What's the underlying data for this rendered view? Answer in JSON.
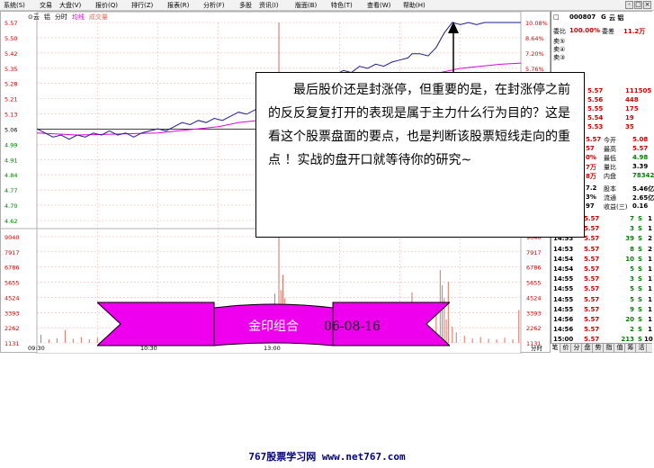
{
  "menu": [
    "系统(S)",
    "交易",
    "大盘(V)",
    "报价(Q)",
    "排行(Z)",
    "报表(R)",
    "分析(F)",
    "多股",
    "资讯(I)",
    "版面(B)",
    "特色(T)",
    "查看(W)",
    "帮助(H)"
  ],
  "window_controls": [
    "-",
    "□",
    "×"
  ],
  "chart": {
    "legend": {
      "prefix": "⊙云",
      "name": "铝",
      "view": "分时",
      "indicator": "均线",
      "volume": "成交量"
    },
    "price_ticks": [
      "5.57",
      "5.50",
      "5.42",
      "5.35",
      "5.28",
      "5.21",
      "5.13",
      "5.06",
      "4.99",
      "4.91",
      "4.84",
      "4.77",
      "4.70",
      "4.62"
    ],
    "pct_ticks": [
      "10.08%",
      "8.64%",
      "7.20%",
      "5.76%"
    ],
    "pct_tick_lower": "8.64%",
    "volume_ticks": [
      "9040",
      "7917",
      "6786",
      "5655",
      "4524",
      "3393",
      "2262",
      "1131"
    ],
    "time_labels": [
      "09:30",
      "10:30",
      "13:00"
    ],
    "bottom_right_label": "分时",
    "price_min": 4.62,
    "price_max": 5.57,
    "volume_max": 9040,
    "price_series": [
      [
        0,
        5.06
      ],
      [
        4,
        5.04
      ],
      [
        8,
        5.02
      ],
      [
        12,
        5.03
      ],
      [
        16,
        5.01
      ],
      [
        20,
        5.03
      ],
      [
        24,
        5.02
      ],
      [
        28,
        5.04
      ],
      [
        32,
        5.03
      ],
      [
        36,
        5.05
      ],
      [
        40,
        5.03
      ],
      [
        44,
        5.04
      ],
      [
        48,
        5.02
      ],
      [
        52,
        5.04
      ],
      [
        56,
        5.05
      ],
      [
        60,
        5.06
      ],
      [
        64,
        5.05
      ],
      [
        68,
        5.07
      ],
      [
        72,
        5.09
      ],
      [
        76,
        5.08
      ],
      [
        80,
        5.1
      ],
      [
        84,
        5.09
      ],
      [
        88,
        5.11
      ],
      [
        92,
        5.1
      ],
      [
        96,
        5.12
      ],
      [
        100,
        5.14
      ],
      [
        104,
        5.13
      ],
      [
        108,
        5.15
      ],
      [
        112,
        5.17
      ],
      [
        116,
        5.16
      ],
      [
        118,
        5.18
      ],
      [
        120,
        5.21
      ],
      [
        124,
        5.24
      ],
      [
        128,
        5.27
      ],
      [
        132,
        5.3
      ],
      [
        136,
        5.29
      ],
      [
        140,
        5.31
      ],
      [
        144,
        5.33
      ],
      [
        148,
        5.32
      ],
      [
        152,
        5.34
      ],
      [
        156,
        5.33
      ],
      [
        160,
        5.36
      ],
      [
        164,
        5.35
      ],
      [
        168,
        5.37
      ],
      [
        172,
        5.36
      ],
      [
        176,
        5.38
      ],
      [
        180,
        5.39
      ],
      [
        184,
        5.4
      ],
      [
        186,
        5.42
      ],
      [
        190,
        5.42
      ],
      [
        194,
        5.41
      ],
      [
        198,
        5.45
      ],
      [
        202,
        5.52
      ],
      [
        206,
        5.57
      ],
      [
        210,
        5.56
      ],
      [
        214,
        5.57
      ],
      [
        218,
        5.56
      ],
      [
        222,
        5.57
      ],
      [
        226,
        5.57
      ],
      [
        230,
        5.57
      ],
      [
        234,
        5.57
      ],
      [
        240,
        5.57
      ]
    ],
    "avg_series": [
      [
        0,
        5.04
      ],
      [
        20,
        5.03
      ],
      [
        40,
        5.035
      ],
      [
        60,
        5.04
      ],
      [
        70,
        5.05
      ],
      [
        80,
        5.06
      ],
      [
        90,
        5.07
      ],
      [
        100,
        5.09
      ],
      [
        110,
        5.1
      ],
      [
        120,
        5.12
      ],
      [
        130,
        5.15
      ],
      [
        140,
        5.2
      ],
      [
        150,
        5.23
      ],
      [
        160,
        5.25
      ],
      [
        170,
        5.27
      ],
      [
        180,
        5.29
      ],
      [
        190,
        5.31
      ],
      [
        200,
        5.33
      ],
      [
        210,
        5.35
      ],
      [
        220,
        5.36
      ],
      [
        230,
        5.37
      ],
      [
        240,
        5.375
      ]
    ],
    "volume_bars": [
      [
        2,
        700
      ],
      [
        6,
        300
      ],
      [
        10,
        400
      ],
      [
        14,
        1100
      ],
      [
        18,
        350
      ],
      [
        22,
        500
      ],
      [
        26,
        300
      ],
      [
        30,
        450
      ],
      [
        34,
        250
      ],
      [
        38,
        400
      ],
      [
        42,
        300
      ],
      [
        46,
        350
      ],
      [
        50,
        250
      ],
      [
        54,
        300
      ],
      [
        58,
        280
      ],
      [
        62,
        260
      ],
      [
        66,
        300
      ],
      [
        70,
        500
      ],
      [
        74,
        320
      ],
      [
        78,
        280
      ],
      [
        82,
        350
      ],
      [
        86,
        300
      ],
      [
        90,
        420
      ],
      [
        94,
        380
      ],
      [
        98,
        500
      ],
      [
        102,
        450
      ],
      [
        104,
        1500
      ],
      [
        106,
        700
      ],
      [
        108,
        400
      ],
      [
        112,
        300
      ],
      [
        116,
        600
      ],
      [
        118,
        4200
      ],
      [
        119,
        3100
      ],
      [
        120,
        5400
      ],
      [
        121,
        4500
      ],
      [
        122,
        5800
      ],
      [
        123,
        3800
      ],
      [
        124,
        2500
      ],
      [
        126,
        1500
      ],
      [
        128,
        900
      ],
      [
        132,
        700
      ],
      [
        136,
        600
      ],
      [
        140,
        500
      ],
      [
        144,
        450
      ],
      [
        148,
        500
      ],
      [
        152,
        600
      ],
      [
        156,
        700
      ],
      [
        160,
        900
      ],
      [
        164,
        600
      ],
      [
        168,
        800
      ],
      [
        172,
        700
      ],
      [
        176,
        1100
      ],
      [
        178,
        2900
      ],
      [
        180,
        3100
      ],
      [
        182,
        1500
      ],
      [
        184,
        2200
      ],
      [
        186,
        4300
      ],
      [
        188,
        1000
      ],
      [
        192,
        800
      ],
      [
        196,
        1200
      ],
      [
        198,
        3300
      ],
      [
        200,
        6200
      ],
      [
        201,
        4900
      ],
      [
        202,
        3800
      ],
      [
        203,
        2000
      ],
      [
        204,
        5200
      ],
      [
        206,
        1400
      ],
      [
        208,
        900
      ],
      [
        212,
        600
      ],
      [
        216,
        400
      ],
      [
        220,
        500
      ],
      [
        224,
        350
      ],
      [
        228,
        300
      ],
      [
        232,
        450
      ],
      [
        236,
        300
      ],
      [
        239,
        2800
      ]
    ]
  },
  "quote": {
    "code": "000807",
    "flag": "G",
    "name": "云 铝",
    "weibi_label": "委比",
    "weibi_value": "100.00%",
    "weicha_label": "委差",
    "weicha_value": "11.2万",
    "sell_levels": [
      "卖⑤",
      "卖④",
      "卖③"
    ],
    "book_rows": [
      {
        "price": "5.57",
        "qty": "111505"
      },
      {
        "price": "5.56",
        "qty": "448"
      },
      {
        "price": "5.55",
        "qty": "175"
      },
      {
        "price": "5.54",
        "qty": "19"
      },
      {
        "price": "5.53",
        "qty": "35"
      }
    ],
    "stats": [
      {
        "left": "5.57",
        "label": "今开",
        "value": "5.08"
      },
      {
        "left": "57",
        "label": "最高",
        "value": "5.57"
      },
      {
        "left": "0%",
        "label": "最低",
        "value": "4.98"
      },
      {
        "left": "7万",
        "label": "量比",
        "value": "3.39"
      },
      {
        "left": "8万",
        "label": "内盘",
        "value": "78342"
      }
    ],
    "fundamentals": [
      {
        "left": "7.2",
        "label": "股本",
        "value": "5.46亿"
      },
      {
        "left": "3%",
        "label": "流通",
        "value": "2.65亿"
      },
      {
        "left": "97",
        "label": "收益(三)",
        "value": "0.16"
      }
    ],
    "ticks": [
      {
        "time": "14:53",
        "price": "5.57",
        "vol": "7",
        "side": "S",
        "n": "1"
      },
      {
        "time": "14:53",
        "price": "5.57",
        "vol": "3",
        "side": "S",
        "n": "1"
      },
      {
        "time": "14:53",
        "price": "5.57",
        "vol": "39",
        "side": "S",
        "n": "2"
      },
      {
        "time": "14:53",
        "price": "5.57",
        "vol": "8",
        "side": "S",
        "n": "2"
      },
      {
        "time": "14:54",
        "price": "5.57",
        "vol": "10",
        "side": "S",
        "n": "1"
      },
      {
        "time": "14:54",
        "price": "5.57",
        "vol": "5",
        "side": "S",
        "n": "1"
      },
      {
        "time": "14:55",
        "price": "5.57",
        "vol": "3",
        "side": "S",
        "n": "1"
      },
      {
        "time": "14:55",
        "price": "5.57",
        "vol": "5",
        "side": "S",
        "n": "1"
      },
      {
        "time": "14:55",
        "price": "5.57",
        "vol": "5",
        "side": "S",
        "n": "1"
      },
      {
        "time": "14:55",
        "price": "5.57",
        "vol": "9",
        "side": "S",
        "n": "1"
      },
      {
        "time": "14:56",
        "price": "5.57",
        "vol": "20",
        "side": "S",
        "n": "1"
      },
      {
        "time": "14:56",
        "price": "5.57",
        "vol": "2",
        "side": "S",
        "n": "1"
      },
      {
        "time": "15:00",
        "price": "5.57",
        "vol": "213",
        "side": "S",
        "n": "10"
      }
    ],
    "tabs": [
      "笔",
      "价",
      "分",
      "盘",
      "势",
      "指",
      "值",
      "筹",
      "活"
    ]
  },
  "annotation": {
    "text": "最后股价还是封涨停，但重要的是，在封涨停之前的反反复复打开的表现是属于主力什么行为目的？这是看这个股票盘面的要点，也是判断该股票短线走向的重点 ！实战的盘开口就等待你的研究~"
  },
  "banner": {
    "name": "金印组合",
    "date": "06-08-16"
  },
  "footer": {
    "text": "767股票学习网 www.net767.com"
  },
  "colors": {
    "price_line": "#1e1e8c",
    "avg_line": "#e000e0",
    "volume_bar": "#e07060",
    "grid_red": "#d04040",
    "banner_fill": "#ee00ee",
    "up_red": "#d00000",
    "down_green": "#008000"
  }
}
